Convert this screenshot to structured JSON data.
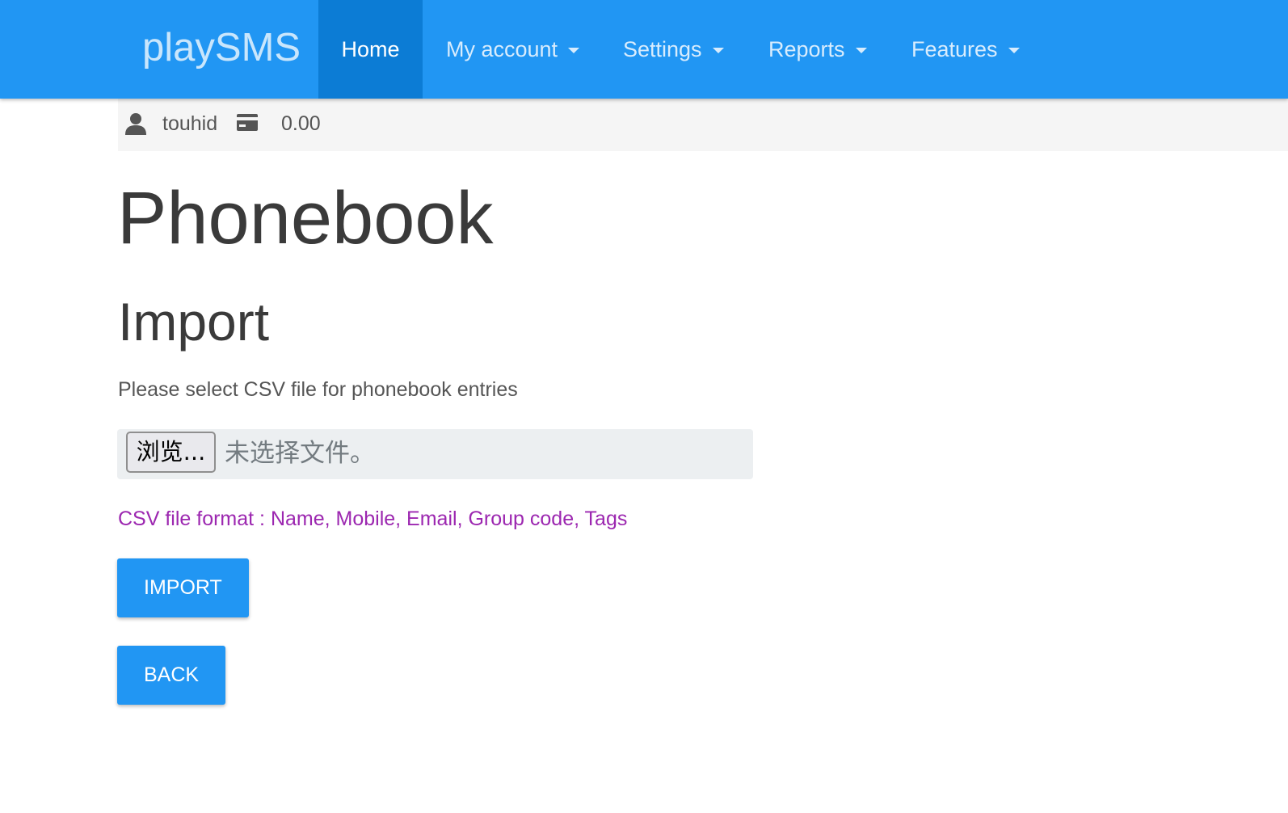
{
  "navbar": {
    "brand": "playSMS",
    "items": [
      {
        "label": "Home",
        "active": true
      },
      {
        "label": "My account",
        "dropdown": true
      },
      {
        "label": "Settings",
        "dropdown": true
      },
      {
        "label": "Reports",
        "dropdown": true
      },
      {
        "label": "Features",
        "dropdown": true
      }
    ],
    "colors": {
      "background": "#2196f3",
      "active_background": "#0c7cd5"
    }
  },
  "userbar": {
    "user_icon": "user-icon",
    "username": "touhid",
    "credit_icon": "credit-card-icon",
    "credit": "0.00"
  },
  "main": {
    "page_title": "Phonebook",
    "section_title": "Import",
    "instruction": "Please select CSV file for phonebook entries",
    "file_input": {
      "browse_label": "浏览...",
      "status": "未选择文件。"
    },
    "format_hint": "CSV file format : Name, Mobile, Email, Group code, Tags",
    "format_hint_color": "#9c27b0",
    "import_label": "IMPORT",
    "back_label": "BACK",
    "button_color": "#2196f3"
  }
}
